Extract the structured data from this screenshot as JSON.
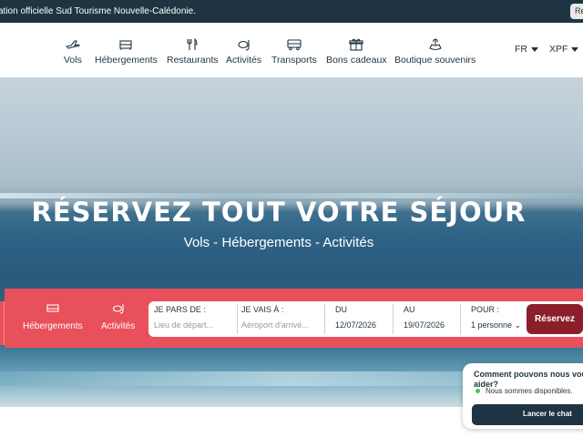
{
  "topbar": {
    "text": "ation officielle Sud Tourisme Nouvelle-Calédonie.",
    "button_label": "Ré"
  },
  "nav": {
    "items": [
      {
        "label": "Vols",
        "icon": "plane-icon"
      },
      {
        "label": "Hébergements",
        "icon": "bed-icon"
      },
      {
        "label": "Restaurants",
        "icon": "cutlery-icon"
      },
      {
        "label": "Activités",
        "icon": "snorkel-icon"
      },
      {
        "label": "Transports",
        "icon": "bus-icon"
      },
      {
        "label": "Bons cadeaux",
        "icon": "gift-icon"
      },
      {
        "label": "Boutique souvenirs",
        "icon": "souvenir-icon"
      }
    ],
    "language": "FR",
    "currency": "XPF"
  },
  "hero": {
    "title": "RÉSERVEZ TOUT VOTRE SÉJOUR",
    "subtitle": "Vols - Hébergements - Activités"
  },
  "booking": {
    "tabs": [
      {
        "label": "Hébergements",
        "icon": "bed-icon"
      },
      {
        "label": "Activités",
        "icon": "snorkel-icon"
      }
    ],
    "from_label": "JE PARS DE :",
    "from_placeholder": "Lieu de départ...",
    "to_label": "JE VAIS À :",
    "to_placeholder": "Aéroport d'arrivé...",
    "start_label": "DU",
    "start_value": "12/07/2026",
    "end_label": "AU",
    "end_value": "19/07/2026",
    "people_label": "POUR :",
    "people_value": "1 personne",
    "submit_label": "Réservez"
  },
  "chat": {
    "question": "Comment pouvons nous vous aider?",
    "status": "Nous sommes disponibles.",
    "button_label": "Lancer le chat",
    "status_color": "#3cc95a"
  },
  "colors": {
    "navy": "#1e3442",
    "coral": "#e8505b",
    "reserve": "#8b1e2a"
  }
}
